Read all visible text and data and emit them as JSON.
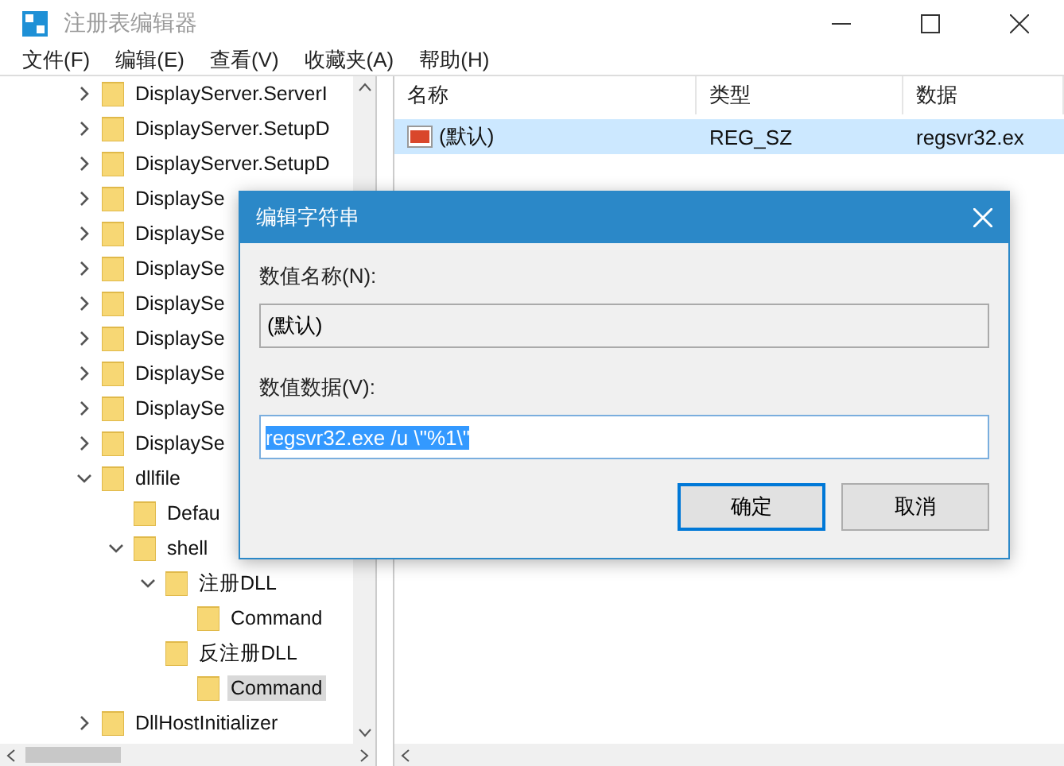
{
  "window": {
    "title": "注册表编辑器"
  },
  "menu": [
    "文件(F)",
    "编辑(E)",
    "查看(V)",
    "收藏夹(A)",
    "帮助(H)"
  ],
  "tree": [
    {
      "label": "DisplayServer.ServerI",
      "expanded": false,
      "selected": false
    },
    {
      "label": "DisplayServer.SetupD",
      "expanded": false,
      "selected": false
    },
    {
      "label": "DisplayServer.SetupD",
      "expanded": false,
      "selected": false
    },
    {
      "label": "DisplaySe",
      "expanded": false,
      "selected": false
    },
    {
      "label": "DisplaySe",
      "expanded": false,
      "selected": false
    },
    {
      "label": "DisplaySe",
      "expanded": false,
      "selected": false
    },
    {
      "label": "DisplaySe",
      "expanded": false,
      "selected": false
    },
    {
      "label": "DisplaySe",
      "expanded": false,
      "selected": false
    },
    {
      "label": "DisplaySe",
      "expanded": false,
      "selected": false
    },
    {
      "label": "DisplaySe",
      "expanded": false,
      "selected": false
    },
    {
      "label": "DisplaySe",
      "expanded": false,
      "selected": false
    },
    {
      "label": "dllfile",
      "expanded": true,
      "selected": false,
      "children": [
        {
          "label": "Defau",
          "selected": false
        },
        {
          "label": "shell",
          "expanded": true,
          "selected": false,
          "children": [
            {
              "label": "注册DLL",
              "expanded": true,
              "selected": false,
              "children": [
                {
                  "label": "Command",
                  "selected": false
                }
              ]
            },
            {
              "label": "反注册DLL",
              "selected": false,
              "children": [
                {
                  "label": "Command",
                  "selected": true
                }
              ]
            }
          ]
        }
      ]
    },
    {
      "label": "DllHostInitializer",
      "expanded": false,
      "selected": false
    }
  ],
  "list": {
    "columns": [
      "名称",
      "类型",
      "数据"
    ],
    "rows": [
      {
        "name": "(默认)",
        "type": "REG_SZ",
        "data": "regsvr32.ex",
        "selected": true
      }
    ]
  },
  "dialog": {
    "title": "编辑字符串",
    "name_label": "数值名称(N):",
    "name_value": "(默认)",
    "data_label": "数值数据(V):",
    "data_value": "regsvr32.exe /u \\\"%1\\\"",
    "data_selected": true,
    "buttons": [
      {
        "label": "确定",
        "default": true
      },
      {
        "label": "取消",
        "default": false
      }
    ]
  }
}
